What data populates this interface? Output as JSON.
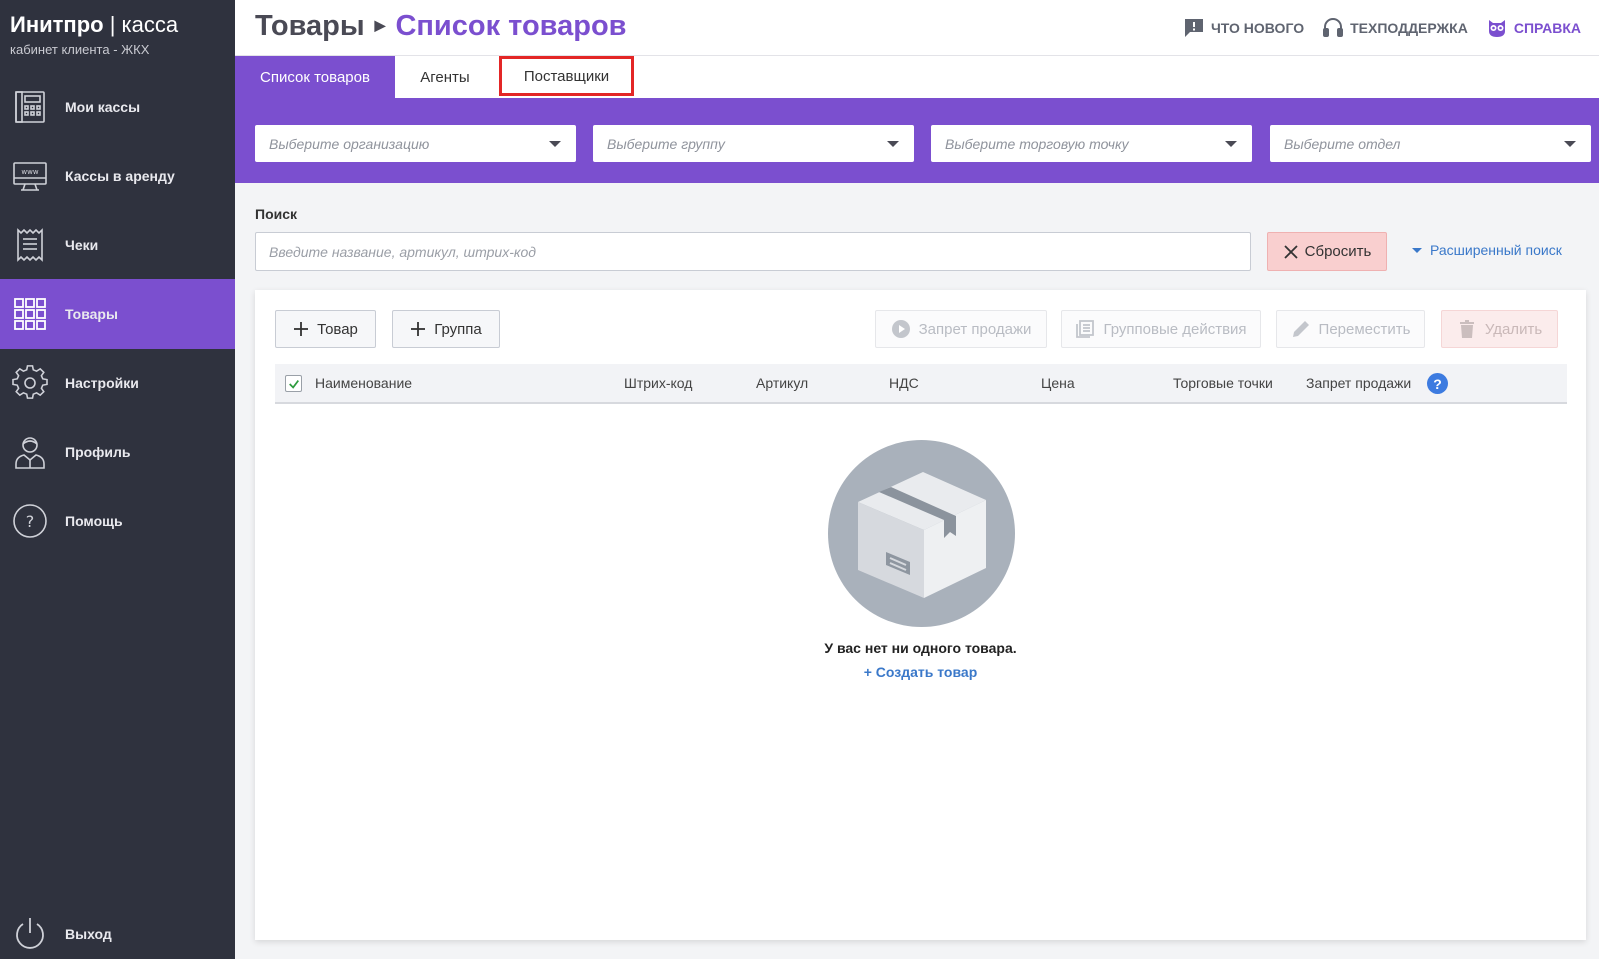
{
  "brand": {
    "name": "Инитпро",
    "separator": " | ",
    "product": "касса",
    "subtitle": "кабинет клиента - ЖКХ"
  },
  "sidebar": {
    "items": [
      {
        "label": "Мои кассы",
        "icon": "cash-register-icon",
        "active": false
      },
      {
        "label": "Кассы в аренду",
        "icon": "monitor-www-icon",
        "active": false
      },
      {
        "label": "Чеки",
        "icon": "receipt-icon",
        "active": false
      },
      {
        "label": "Товары",
        "icon": "grid-icon",
        "active": true
      },
      {
        "label": "Настройки",
        "icon": "gear-icon",
        "active": false
      },
      {
        "label": "Профиль",
        "icon": "user-icon",
        "active": false
      },
      {
        "label": "Помощь",
        "icon": "help-icon",
        "active": false
      }
    ],
    "logout": {
      "label": "Выход",
      "icon": "power-icon"
    }
  },
  "header": {
    "breadcrumb_root": "Товары",
    "breadcrumb_current": "Список товаров",
    "links": [
      {
        "label": "ЧТО НОВОГО",
        "icon": "message-alert-icon"
      },
      {
        "label": "ТЕХПОДДЕРЖКА",
        "icon": "headset-icon"
      },
      {
        "label": "СПРАВКА",
        "icon": "owl-icon"
      }
    ]
  },
  "tabs": [
    {
      "label": "Список товаров",
      "active": true
    },
    {
      "label": "Агенты",
      "active": false
    },
    {
      "label": "Поставщики",
      "active": false,
      "highlighted": true
    }
  ],
  "filters": {
    "organization": "Выберите организацию",
    "group": "Выберите группу",
    "point": "Выберите торговую точку",
    "department": "Выберите отдел"
  },
  "search": {
    "label": "Поиск",
    "placeholder": "Введите название, артикул, штрих-код",
    "value": "",
    "reset_label": "Сбросить",
    "advanced_label": "Расширенный поиск"
  },
  "toolbar": {
    "add_product": "Товар",
    "add_group": "Группа",
    "ban_sale": "Запрет продажи",
    "group_actions": "Групповые действия",
    "move": "Переместить",
    "delete": "Удалить"
  },
  "table": {
    "columns": [
      "Наименование",
      "Штрих-код",
      "Артикул",
      "НДС",
      "Цена",
      "Торговые точки",
      "Запрет продажи"
    ],
    "select_all_checked": true,
    "rows": []
  },
  "empty_state": {
    "message": "У вас нет ни одного товара.",
    "create_link": "+ Создать товар"
  },
  "colors": {
    "accent": "#7b4fcf",
    "sidebar_bg": "#2f323e",
    "link": "#3a78c9",
    "reset_bg": "#f9cfcf",
    "highlight_border": "#e32626"
  }
}
